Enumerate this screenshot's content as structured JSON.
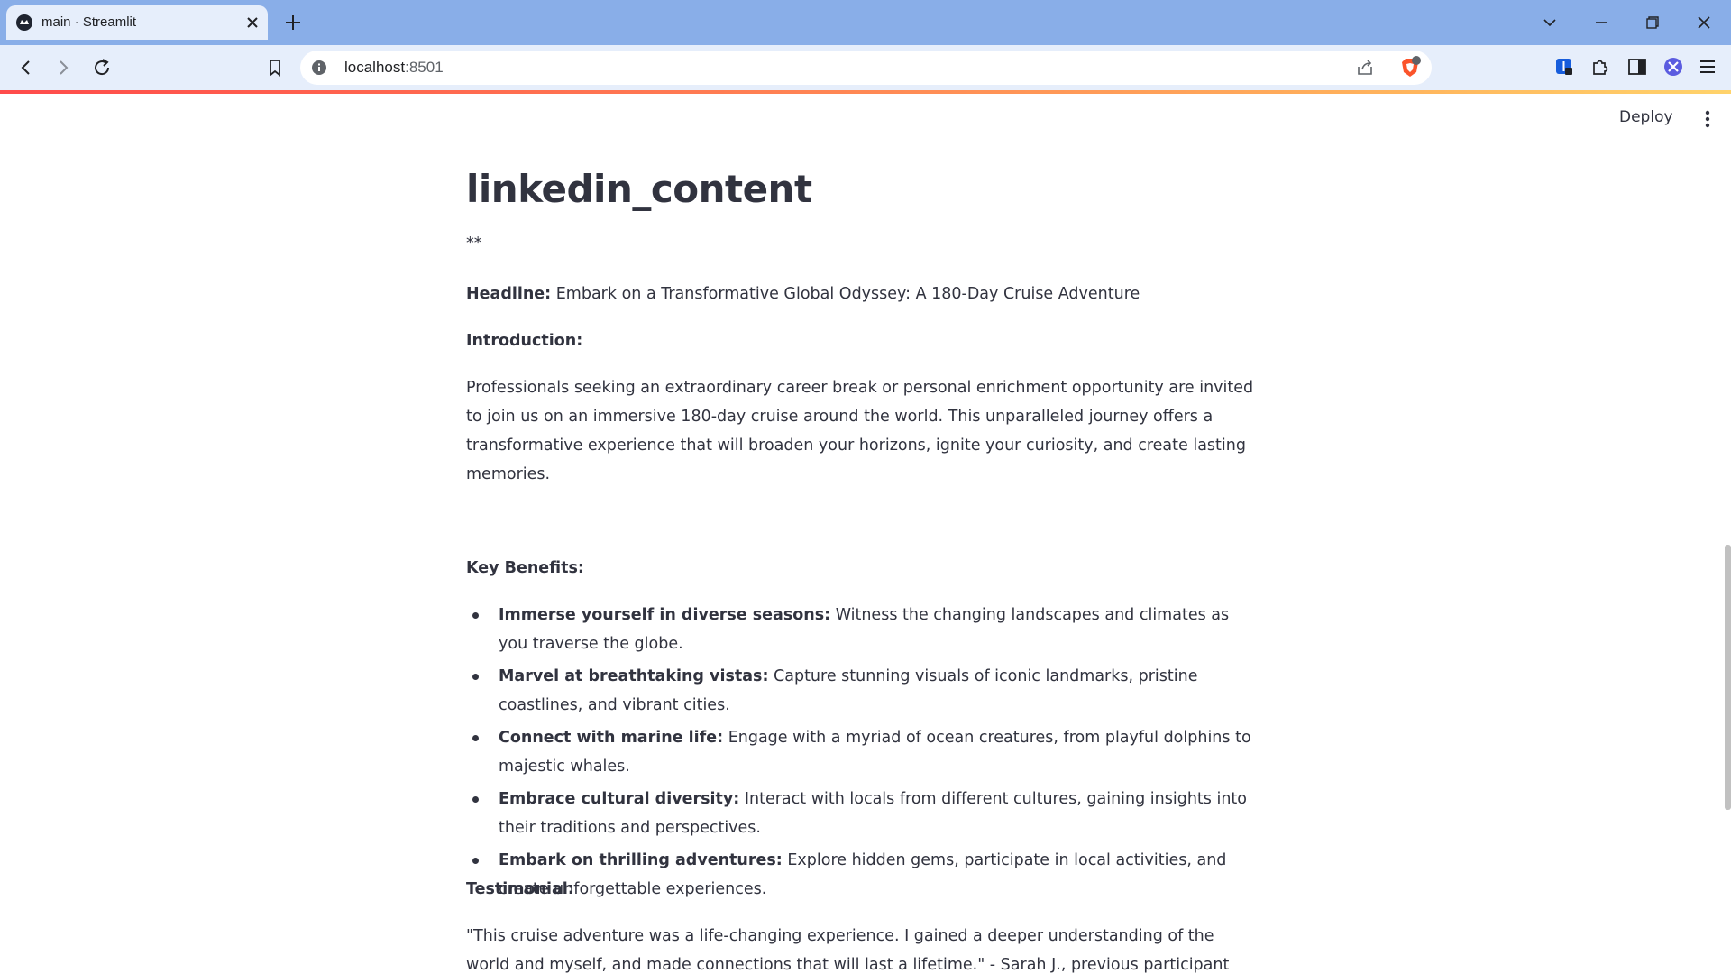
{
  "browser": {
    "tab_title": "main · Streamlit",
    "url_host": "localhost",
    "url_port": ":8501"
  },
  "app": {
    "deploy_label": "Deploy"
  },
  "content": {
    "title": "linkedin_content",
    "stars": "**",
    "headline_label": "Headline:",
    "headline_text": " Embark on a Transformative Global Odyssey: A 180-Day Cruise Adventure",
    "intro_label": "Introduction:",
    "intro_text": "Professionals seeking an extraordinary career break or personal enrichment opportunity are invited to join us on an immersive 180-day cruise around the world. This unparalleled journey offers a transformative experience that will broaden your horizons, ignite your curiosity, and create lasting memories.",
    "benefits_label": "Key Benefits:",
    "benefits": [
      {
        "title": "Immerse yourself in diverse seasons:",
        "text": " Witness the changing landscapes and climates as you traverse the globe."
      },
      {
        "title": "Marvel at breathtaking vistas:",
        "text": " Capture stunning visuals of iconic landmarks, pristine coastlines, and vibrant cities."
      },
      {
        "title": "Connect with marine life:",
        "text": " Engage with a myriad of ocean creatures, from playful dolphins to majestic whales."
      },
      {
        "title": "Embrace cultural diversity:",
        "text": " Interact with locals from different cultures, gaining insights into their traditions and perspectives."
      },
      {
        "title": "Embark on thrilling adventures:",
        "text": " Explore hidden gems, participate in local activities, and create unforgettable experiences."
      }
    ],
    "testimonial_label": "Testimonial:",
    "testimonial_text": "\"This cruise adventure was a life-changing experience. I gained a deeper understanding of the world and myself, and made connections that will last a lifetime.\" - Sarah J., previous participant"
  },
  "colors": {
    "tabbar": "#89aee8",
    "toolbar": "#e6eefb",
    "text": "#31333f",
    "streamlit_accent": "#ff4b4b"
  }
}
